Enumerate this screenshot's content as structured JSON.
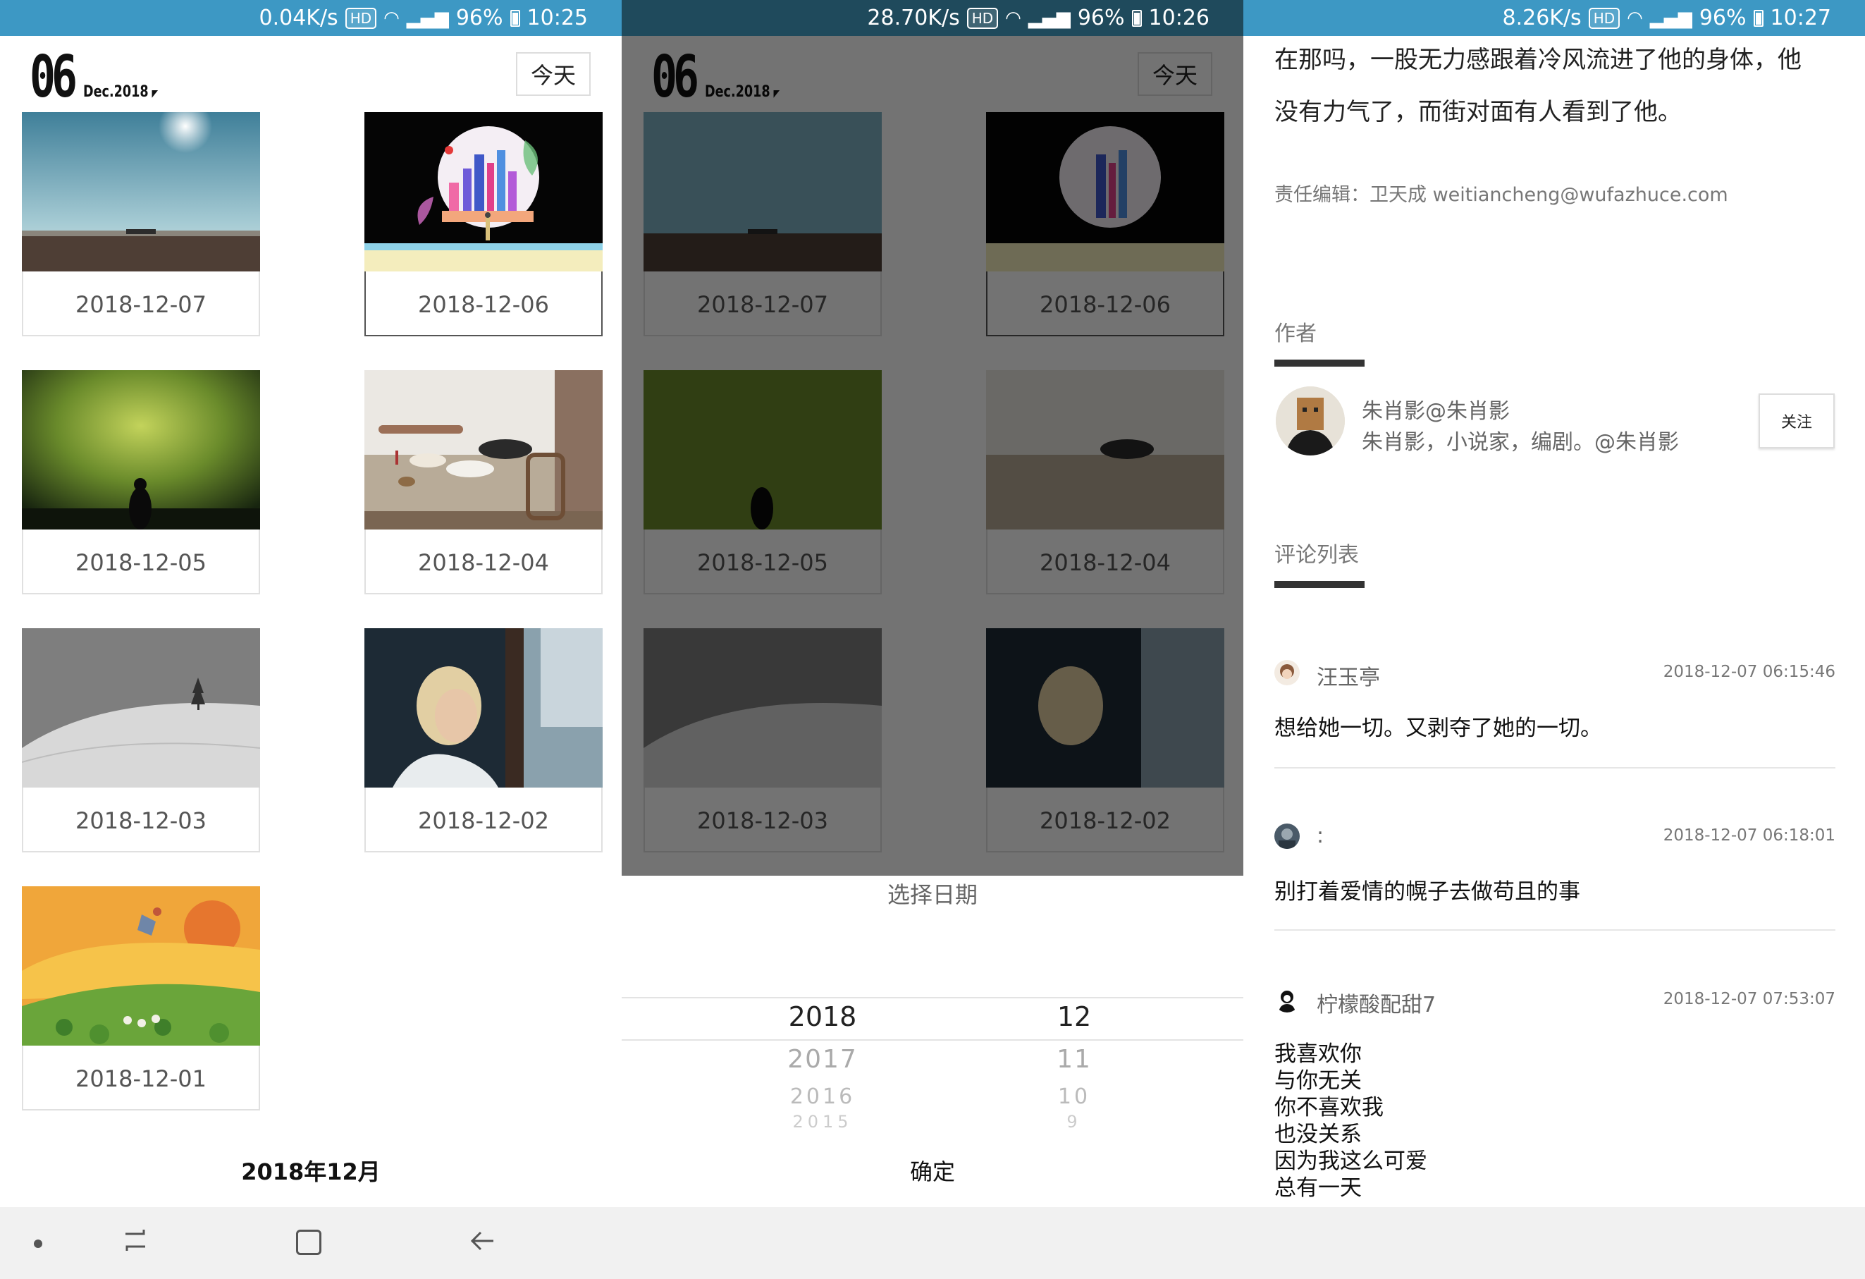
{
  "panel1": {
    "status": {
      "speed": "0.04K/s",
      "hd": "HD",
      "battery": "96%",
      "time": "10:25"
    },
    "header": {
      "day": "06",
      "month_year": "Dec.2018",
      "dropdown_glyph": "◤",
      "today_label": "今天"
    },
    "cards": [
      {
        "date": "2018-12-07",
        "image": "desert-plane-wreck"
      },
      {
        "date": "2018-12-06",
        "image": "city-moon-illustration"
      },
      {
        "date": "2018-12-05",
        "image": "aurora-silhouette"
      },
      {
        "date": "2018-12-04",
        "image": "dining-table"
      },
      {
        "date": "2018-12-03",
        "image": "snowy-hill-tree"
      },
      {
        "date": "2018-12-02",
        "image": "boy-at-window"
      },
      {
        "date": "2018-12-01",
        "image": "girl-flying-painting"
      }
    ],
    "bottom_month": "2018年12月"
  },
  "panel2": {
    "status": {
      "speed": "28.70K/s",
      "hd": "HD",
      "battery": "96%",
      "time": "10:26"
    },
    "picker": {
      "title": "选择日期",
      "years": [
        "2018",
        "2017",
        "2016",
        "2015"
      ],
      "months": [
        "12",
        "11",
        "10",
        "9"
      ],
      "confirm": "确定"
    }
  },
  "panel3": {
    "status": {
      "speed": "8.26K/s",
      "hd": "HD",
      "battery": "96%",
      "time": "10:27"
    },
    "article_lines": [
      "在那吗，一股无力感跟着冷风流进了他的身体，他",
      "没有力气了，而街对面有人看到了他。"
    ],
    "editor": "责任编辑：卫天成 weitiancheng@wufazhuce.com",
    "author_section": "作者",
    "author": {
      "name": "朱肖影@朱肖影",
      "bio": "朱肖影，小说家，编剧。@朱肖影",
      "follow": "关注"
    },
    "comments_section": "评论列表",
    "comments": [
      {
        "user": "汪玉亭",
        "time": "2018-12-07 06:15:46",
        "text": "想给她一切。又剥夺了她的一切。"
      },
      {
        "user": ":",
        "time": "2018-12-07 06:18:01",
        "text": "别打着爱情的幌子去做苟且的事"
      },
      {
        "user": "柠檬酸配甜7",
        "time": "2018-12-07 07:53:07",
        "text": [
          "我喜欢你",
          "与你无关",
          "你不喜欢我",
          "也没关系",
          "因为我这么可爱",
          "总有一天"
        ]
      }
    ]
  },
  "navbar": {
    "icons": [
      "dot-icon",
      "recent-apps-icon",
      "home-icon",
      "back-icon"
    ]
  }
}
